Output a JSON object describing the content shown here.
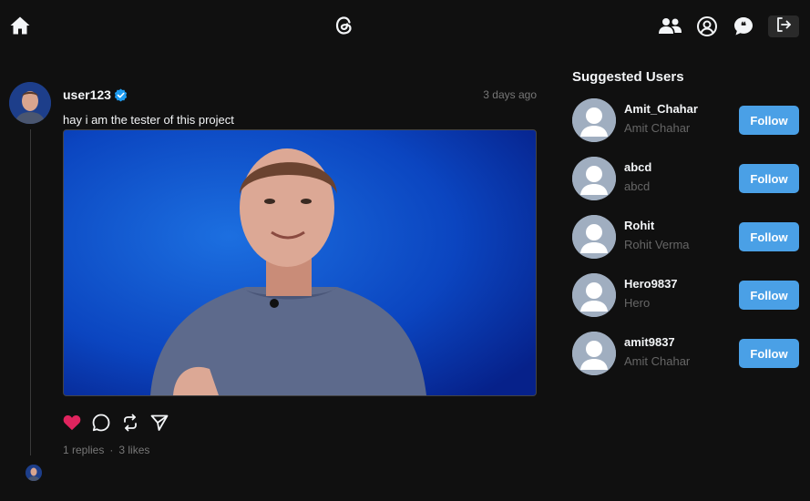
{
  "header": {
    "icons": [
      "home-icon",
      "threads-logo-icon",
      "users-icon",
      "profile-icon",
      "chat-icon",
      "logout-icon"
    ]
  },
  "post": {
    "username": "user123",
    "time": "3 days ago",
    "text": "hay i am the tester of this project",
    "replies": "1 replies",
    "dot": "·",
    "likes": "3 likes",
    "liked": true,
    "like_color": "#e0245e"
  },
  "suggested": {
    "title": "Suggested Users",
    "users": [
      {
        "username": "Amit_Chahar",
        "name": "Amit Chahar",
        "button": "Follow"
      },
      {
        "username": "abcd",
        "name": "abcd",
        "button": "Follow"
      },
      {
        "username": "Rohit",
        "name": "Rohit Verma",
        "button": "Follow"
      },
      {
        "username": "Hero9837",
        "name": "Hero",
        "button": "Follow"
      },
      {
        "username": "amit9837",
        "name": "Amit Chahar",
        "button": "Follow"
      }
    ],
    "button_color": "#4aa0e6"
  }
}
